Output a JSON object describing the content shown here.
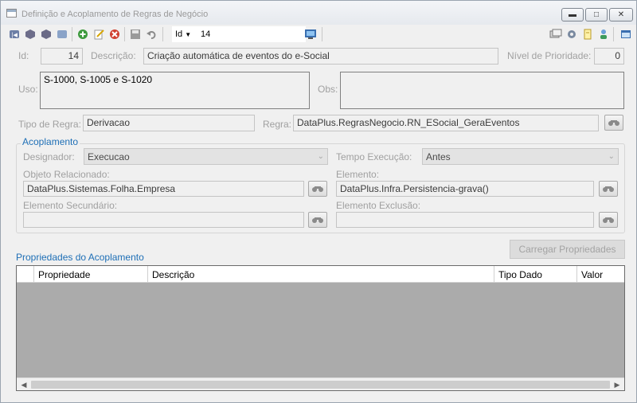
{
  "window": {
    "title": "Definição e Acoplamento de Regras de Negócio"
  },
  "toolbar": {
    "id_label": "Id",
    "id_value": "14"
  },
  "form": {
    "id": {
      "label": "Id:",
      "value": "14"
    },
    "descricao": {
      "label": "Descrição:",
      "value": "Criação automática de eventos do e-Social"
    },
    "prioridade": {
      "label": "Nível de Prioridade:",
      "value": "0"
    },
    "uso": {
      "label": "Uso:",
      "value": "S-1000, S-1005 e S-1020"
    },
    "obs": {
      "label": "Obs:",
      "value": ""
    },
    "tipo_regra": {
      "label": "Tipo de Regra:",
      "value": "Derivacao"
    },
    "regra": {
      "label": "Regra:",
      "value": "DataPlus.RegrasNegocio.RN_ESocial_GeraEventos"
    }
  },
  "acoplamento": {
    "title": "Acoplamento",
    "designador": {
      "label": "Designador:",
      "value": "Execucao"
    },
    "tempo_execucao": {
      "label": "Tempo Execução:",
      "value": "Antes"
    },
    "objeto_relacionado": {
      "label": "Objeto Relacionado:",
      "value": "DataPlus.Sistemas.Folha.Empresa"
    },
    "elemento": {
      "label": "Elemento:",
      "value": "DataPlus.Infra.Persistencia-grava()"
    },
    "elemento_secundario": {
      "label": "Elemento Secundário:",
      "value": ""
    },
    "elemento_exclusao": {
      "label": "Elemento Exclusão:",
      "value": ""
    }
  },
  "propriedades": {
    "title": "Propriedades do Acoplamento",
    "load_button": "Carregar Propriedades",
    "columns": [
      "Propriedade",
      "Descrição",
      "Tipo Dado",
      "Valor"
    ]
  }
}
